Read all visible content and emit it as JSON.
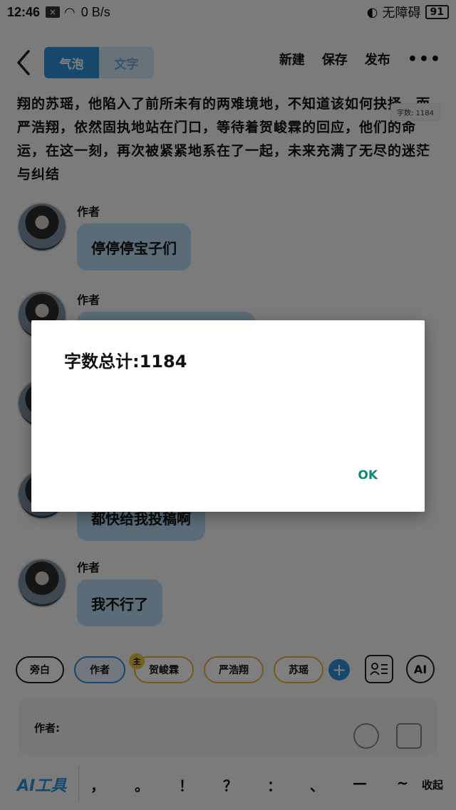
{
  "status_bar": {
    "time": "12:46",
    "network_speed": "0 B/s",
    "accessibility": "无障碍",
    "battery": "91"
  },
  "header": {
    "tabs": [
      {
        "label": "气泡",
        "active": true
      },
      {
        "label": "文字",
        "active": false
      }
    ],
    "actions": {
      "new": "新建",
      "save": "保存",
      "publish": "发布",
      "more": "•••"
    }
  },
  "content": {
    "paragraph": "翔的苏瑶，他陷入了前所未有的两难境地，不知道该如何抉择，而严浩翔，依然固执地站在门口，等待着贺峻霖的回应，他们的命运，在这一刻，再次被紧紧地系在了一起，未来充满了无尽的迷茫与纠结",
    "word_count_badge": "字数: 1184",
    "messages": [
      {
        "author": "作者",
        "text": "停停停宝子们"
      },
      {
        "author": "作者",
        "text": ""
      },
      {
        "author": "",
        "text": ""
      },
      {
        "author": "",
        "text": "都快给我投稿啊"
      },
      {
        "author": "作者",
        "text": "我不行了"
      }
    ]
  },
  "characters": {
    "chips": [
      "旁白",
      "作者",
      "贺峻霖",
      "严浩翔",
      "苏瑶"
    ],
    "main_badge": "主",
    "add": "+",
    "ai": "AI"
  },
  "input": {
    "speaker_label": "作者:"
  },
  "toolbar": {
    "ai_tools": "AI工具",
    "punctuation": [
      "，",
      "。",
      "！",
      "？",
      "：",
      "、",
      "—",
      "~"
    ],
    "collapse": "收起"
  },
  "dialog": {
    "message": "字数总计:1184",
    "ok": "OK"
  },
  "colors": {
    "accent": "#2f8fd6",
    "bubble": "#b5d9f0",
    "ok": "#0b8a7a",
    "chip_outline": "#e6b23a"
  }
}
